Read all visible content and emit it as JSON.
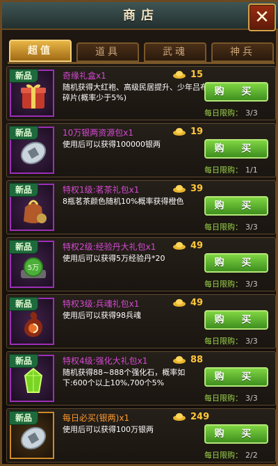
{
  "header": {
    "title": "商店",
    "close_icon": "close-icon"
  },
  "tabs": [
    {
      "label": "超值"
    },
    {
      "label": "道具"
    },
    {
      "label": "武魂"
    },
    {
      "label": "神兵"
    }
  ],
  "buy_label": "购 买",
  "new_label": "新品",
  "limit_label": "每日限购：",
  "items": [
    {
      "name": "奇缘礼盒x1",
      "desc": "随机获得大红袍、高级民居提升、少年吕布碎片(概率少于5%)",
      "price": "15",
      "limit": "3/3",
      "icon": "gift-box-icon"
    },
    {
      "name": "10万银两资源包x1",
      "desc": "使用后可以获得100000银两",
      "price": "19",
      "limit": "1/1",
      "icon": "silver-coin-icon"
    },
    {
      "name": "特权1级:茗茶礼包x1",
      "desc": "8瓶茗茶颜色随机10%概率获得橙色",
      "price": "39",
      "limit": "3/3",
      "icon": "tea-bag-icon"
    },
    {
      "name": "特权2级:经验丹大礼包x1",
      "desc": "使用后可以获得5万经验丹*20",
      "price": "49",
      "limit": "3/3",
      "icon": "exp-pill-icon"
    },
    {
      "name": "特权3级:兵魂礼包x1",
      "desc": "使用后可以获得98兵魂",
      "price": "49",
      "limit": "3/3",
      "icon": "soul-gourd-icon"
    },
    {
      "name": "特权4级:强化大礼包x1",
      "desc": "随机获得88~888个强化石，概率如下:600个以上10%,700个5%",
      "price": "88",
      "limit": "3/3",
      "icon": "green-gem-icon"
    },
    {
      "name": "每日必买(银两)x1",
      "desc": "使用后可以获得100万银两",
      "price": "249",
      "limit": "2/2",
      "icon": "silver-coin-icon"
    }
  ],
  "colors": {
    "accent": "#7fd542",
    "name_purple": "#d44ad2",
    "name_orange": "#ff9b2f",
    "gold": "#ffc73a"
  }
}
